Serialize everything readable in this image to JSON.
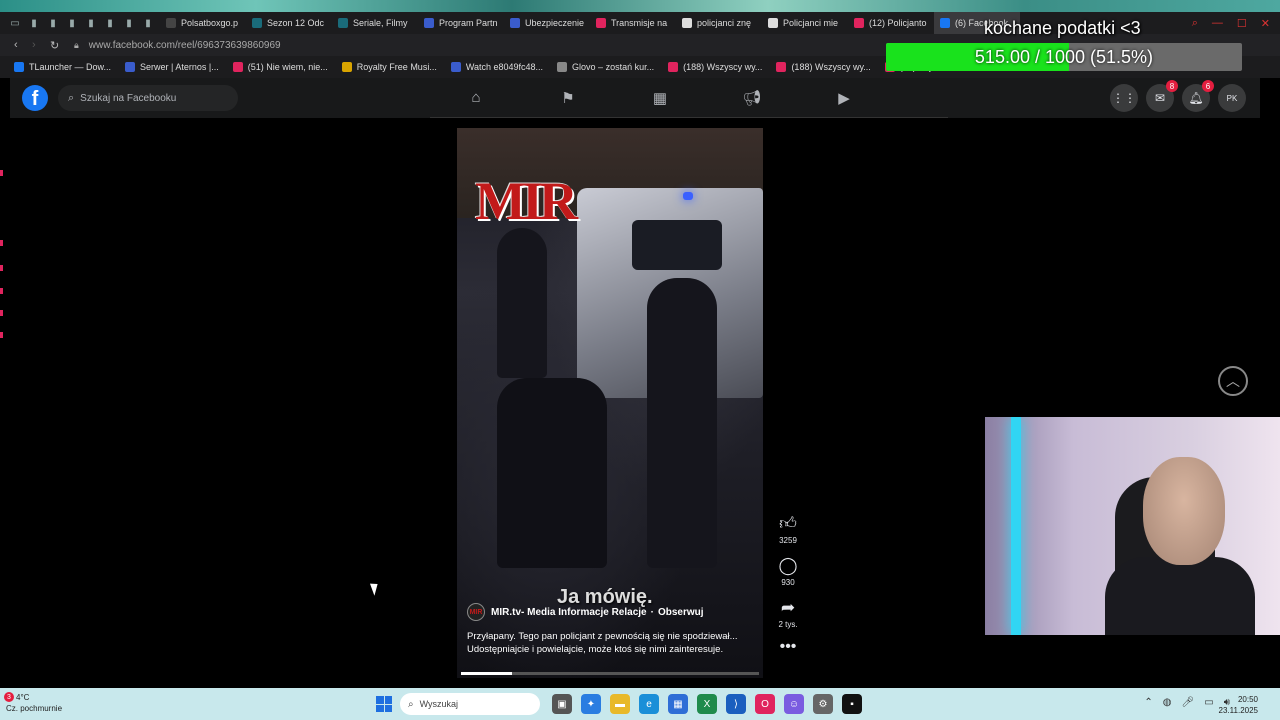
{
  "browser": {
    "tabs": [
      {
        "label": "Polsatboxgo.p",
        "fav_color": "#444"
      },
      {
        "label": "Sezon 12 Odc",
        "fav_color": "#1a6b7a"
      },
      {
        "label": "Seriale, Filmy",
        "fav_color": "#1a6b7a"
      },
      {
        "label": "Program Partn",
        "fav_color": "#3a5ccc"
      },
      {
        "label": "Ubezpieczenie",
        "fav_color": "#3a5ccc"
      },
      {
        "label": "Transmisje na",
        "fav_color": "#e0245e"
      },
      {
        "label": "policjanci znę",
        "fav_color": "#ddd"
      },
      {
        "label": "Policjanci mie",
        "fav_color": "#ddd"
      },
      {
        "label": "(12) Policjanto",
        "fav_color": "#e0245e"
      },
      {
        "label": "(6) Facebook",
        "fav_color": "#1877f2",
        "active": true
      }
    ],
    "url": "www.facebook.com/reel/696373639860969",
    "bookmarks": [
      {
        "label": "TLauncher — Dow...",
        "fav_color": "#1877f2"
      },
      {
        "label": "Serwer | Aternos |...",
        "fav_color": "#3a5ccc"
      },
      {
        "label": "(51) Nie wiem, nie...",
        "fav_color": "#e0245e"
      },
      {
        "label": "Royalty Free Musi...",
        "fav_color": "#d9a400"
      },
      {
        "label": "Watch e8049fc48...",
        "fav_color": "#3a5ccc"
      },
      {
        "label": "Glovo – zostań kur...",
        "fav_color": "#888"
      },
      {
        "label": "(188) Wszyscy wy...",
        "fav_color": "#e0245e"
      },
      {
        "label": "(188) Wszyscy wy...",
        "fav_color": "#e0245e"
      },
      {
        "label": "(19) Pajal",
        "fav_color": "#e0245e"
      }
    ]
  },
  "overlay": {
    "donation_title": "kochane podatki <3",
    "donation_text": "515.00 / 1000 (51.5%)",
    "donation_fraction": 0.515
  },
  "facebook": {
    "logo": "f",
    "search_placeholder": "Szukaj na Facebooku",
    "nav_icons": [
      "home-icon",
      "flag-icon",
      "marketplace-icon",
      "megaphone-icon",
      "video-icon"
    ],
    "messenger_badge": "8",
    "notifications_badge": "6",
    "avatar_initials": "PK"
  },
  "reel": {
    "logo_text": "MIR",
    "overlay_caption": "Ja mówię.",
    "author": "MIR.tv- Media Informacje Relacje",
    "follow_label": "Obserwuj",
    "description_line1": "Przyłapany. Tego pan policjant z pewnością się nie spodziewał...",
    "description_line2": "Udostępniajcie i powielajcie, może ktoś się nimi zainteresuje.",
    "progress_fraction": 0.17,
    "likes": "3259",
    "comments": "930",
    "shares": "2 tys."
  },
  "taskbar": {
    "weather_temp": "4°C",
    "weather_desc": "Cz. pochmurnie",
    "weather_badge": "3",
    "search_placeholder": "Wyszukaj",
    "time": "20:50",
    "date": "23.11.2025"
  }
}
